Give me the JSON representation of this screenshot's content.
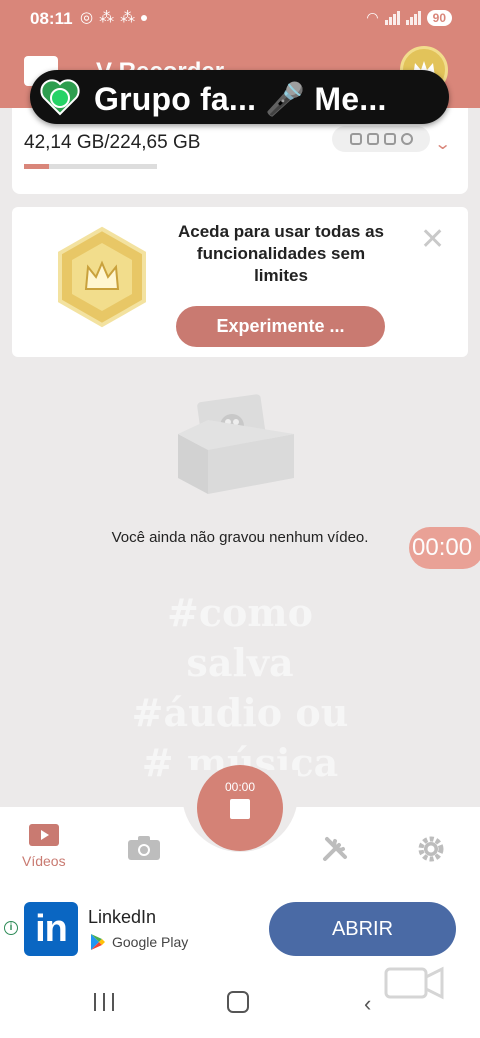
{
  "status_bar": {
    "time": "08:11",
    "battery": "90"
  },
  "header": {
    "title": "V Recorder"
  },
  "notification_overlay": {
    "text": "Grupo fa... 🎤 Me..."
  },
  "storage": {
    "text": "42,14 GB/224,65 GB",
    "used_fraction": 0.19
  },
  "promo": {
    "text": "Aceda para usar todas as funcionalidades sem limites",
    "button_label": "Experimente ...",
    "close_glyph": "✕"
  },
  "empty_state": {
    "message": "Você ainda não gravou nenhum vídeo."
  },
  "floating_timer": {
    "text": "00:00"
  },
  "watermark_lines": [
    "#como",
    "salva",
    "#áudio ou",
    "# música"
  ],
  "record": {
    "time": "00:00"
  },
  "bottom_nav": {
    "items": [
      {
        "icon": "video-icon",
        "label": "Vídeos",
        "active": true
      },
      {
        "icon": "camera-icon",
        "label": "",
        "active": false
      },
      {
        "icon": "tools-icon",
        "label": "",
        "active": false
      },
      {
        "icon": "settings-icon",
        "label": "",
        "active": false
      }
    ]
  },
  "ad": {
    "app_name": "LinkedIn",
    "store": "Google Play",
    "button_label": "ABRIR",
    "logo_text": "in"
  },
  "colors": {
    "accent": "#d9867a",
    "ad_button": "#4a6aa5",
    "linkedin_blue": "#0a66c2"
  }
}
